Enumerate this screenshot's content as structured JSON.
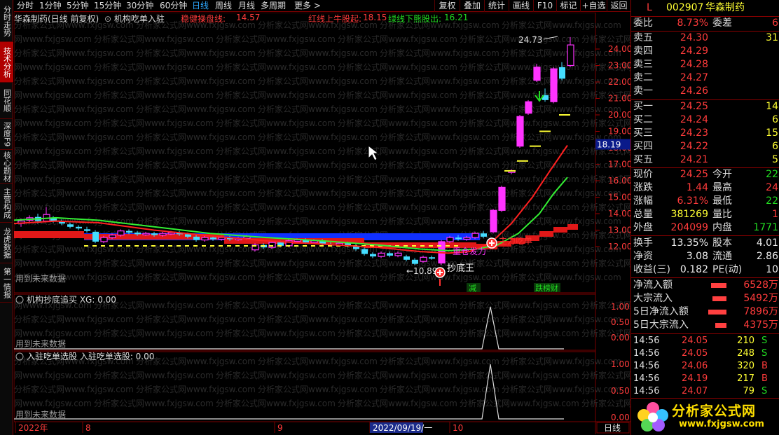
{
  "left_tabs": [
    {
      "label": "分时走势",
      "active": false
    },
    {
      "label": "技术分析",
      "active": true
    },
    {
      "label": "同花顺",
      "active": false
    },
    {
      "label": "深度F9",
      "active": false
    },
    {
      "label": "核心题材",
      "active": false
    },
    {
      "label": "主营构成",
      "active": false
    },
    {
      "label": "龙虎数据",
      "active": false
    },
    {
      "label": "第一情报",
      "active": false
    }
  ],
  "periods": [
    "分时",
    "1分钟",
    "5分钟",
    "15分钟",
    "30分钟",
    "60分钟",
    "日线",
    "周线",
    "月线",
    "多周期",
    "更多 >"
  ],
  "selected_period": "日线",
  "toolbar_buttons": [
    "复权",
    "叠加",
    "统计",
    "画线",
    "F10",
    "标记",
    "+自选",
    "返回"
  ],
  "chart_header": {
    "title": "华森制药(日线 前复权)",
    "indicator": "机构吃单入驻",
    "line1_label": "稳健操盘线:",
    "line1_value": "14.57",
    "line2_label": "红线上牛股起:",
    "line2_value": "18.15",
    "line3_label": "绿线下熊股出:",
    "line3_value": "16.21"
  },
  "colors": {
    "up": "#ff33ff",
    "down": "#44ddff",
    "red_line": "#ff2020",
    "green_line": "#33ee33",
    "blue_band": "#1030ff",
    "accent_red": "#ff3b3b",
    "accent_green": "#22dd22",
    "accent_yellow": "#ffff33"
  },
  "main_chart": {
    "y_ticks": [
      "24.00",
      "23.00",
      "22.00",
      "21.00",
      "20.00",
      "19.00",
      "18.00",
      "17.00",
      "16.00",
      "15.00",
      "14.00",
      "13.00",
      "12.00"
    ],
    "current_price_tag": "18.19",
    "high_label": "24.73",
    "low_label": "10.89",
    "annotation_buy": "抄底王",
    "annotation_dark": "重仓发力",
    "annotation_mid": "主力吃单",
    "watermark": "分析家公式网www.fxjgsw.com",
    "future_data_note": "用到未来数据",
    "event_tags": [
      "减",
      "跌榜财"
    ]
  },
  "sub1": {
    "title": "机构抄底追买",
    "xg_label": "XG:",
    "xg_value": "0.00",
    "y_ticks": [
      "1.00",
      "0.50",
      "0.00"
    ],
    "note": "用到未来数据"
  },
  "sub2": {
    "title": "入驻吃单选股",
    "label": "入驻吃单选股:",
    "value": "0.00",
    "y_ticks": [
      "1.00",
      "0.50",
      "0.00"
    ],
    "note": "用到未来数据"
  },
  "x_axis": {
    "labels": [
      "2022年",
      "8",
      "9",
      "2022/09/19/一",
      "10"
    ],
    "period_button": "日线"
  },
  "quote": {
    "flag": "L",
    "code": "002907",
    "name": "华森制药",
    "weibi_label": "委比",
    "weibi_value": "8.73%",
    "weicha_label": "委差",
    "weicha_value": "6",
    "asks": [
      {
        "label": "卖五",
        "price": "24.30",
        "vol": "31"
      },
      {
        "label": "卖四",
        "price": "24.29",
        "vol": ""
      },
      {
        "label": "卖三",
        "price": "24.28",
        "vol": ""
      },
      {
        "label": "卖二",
        "price": "24.27",
        "vol": ""
      },
      {
        "label": "卖一",
        "price": "24.26",
        "vol": ""
      }
    ],
    "bids": [
      {
        "label": "买一",
        "price": "24.25",
        "vol": "14"
      },
      {
        "label": "买二",
        "price": "24.24",
        "vol": "6"
      },
      {
        "label": "买三",
        "price": "24.23",
        "vol": "15"
      },
      {
        "label": "买四",
        "price": "24.22",
        "vol": "6"
      },
      {
        "label": "买五",
        "price": "24.21",
        "vol": "5"
      }
    ],
    "stats": [
      {
        "l1": "现价",
        "v1": "24.25",
        "c1": "red",
        "l2": "今开",
        "v2": "22",
        "c2": "green"
      },
      {
        "l1": "涨跌",
        "v1": "1.44",
        "c1": "red",
        "l2": "最高",
        "v2": "24",
        "c2": "red"
      },
      {
        "l1": "涨幅",
        "v1": "6.31%",
        "c1": "red",
        "l2": "最低",
        "v2": "22",
        "c2": "green"
      },
      {
        "l1": "总量",
        "v1": "381269",
        "c1": "yellow",
        "l2": "量比",
        "v2": "1",
        "c2": "red"
      },
      {
        "l1": "外盘",
        "v1": "204099",
        "c1": "red",
        "l2": "内盘",
        "v2": "1771",
        "c2": "green"
      }
    ],
    "stats2": [
      {
        "l1": "换手",
        "v1": "13.35%",
        "c1": "white",
        "l2": "股本",
        "v2": "4.01",
        "c2": "white"
      },
      {
        "l1": "净资",
        "v1": "3.08",
        "c1": "white",
        "l2": "流通",
        "v2": "2.86",
        "c2": "white"
      },
      {
        "l1": "收益(三)",
        "v1": "0.182",
        "c1": "white",
        "l2": "PE(动)",
        "v2": "10",
        "c2": "white"
      }
    ],
    "flows": [
      {
        "label": "净流入额",
        "value": "6528万"
      },
      {
        "label": "大宗流入",
        "value": "5492万"
      },
      {
        "label": "5日净流入额",
        "value": "7896万"
      },
      {
        "label": "5日大宗流入",
        "value": "4375万"
      }
    ],
    "ticks": [
      {
        "time": "14:56",
        "price": "24.05",
        "vol": "210",
        "side": "S"
      },
      {
        "time": "14:56",
        "price": "24.05",
        "vol": "248",
        "side": "S"
      },
      {
        "time": "14:56",
        "price": "24.06",
        "vol": "320",
        "side": "B"
      },
      {
        "time": "14:56",
        "price": "24.19",
        "vol": "217",
        "side": "B"
      },
      {
        "time": "14:56",
        "price": "24.07",
        "vol": "79",
        "side": "S"
      }
    ],
    "logo_text": "分析家公式网",
    "logo_url": "www.fxjgsw.com"
  }
}
